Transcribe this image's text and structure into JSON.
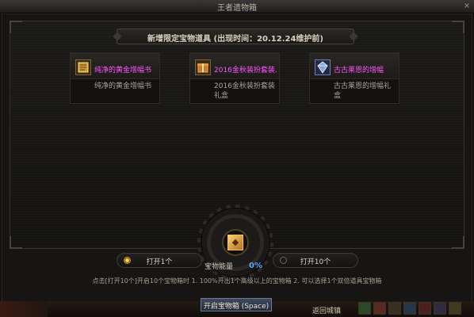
{
  "window": {
    "title": "王者遗物箱",
    "close_glyph": "×"
  },
  "banner": {
    "text": "新增限定宝物道具 (出现时间：20.12.24维护前)"
  },
  "items": [
    {
      "name": "纯净的黄金增幅书",
      "desc": "纯净的黄金增幅书",
      "icon": "gold-book-icon",
      "icon_color": "#c89a3a"
    },
    {
      "name": "2016金秋装扮套装…",
      "desc": "2016金秋装扮套装礼盒",
      "icon": "gift-box-icon",
      "icon_color": "#c77a2a"
    },
    {
      "name": "古古莱恩的增幅",
      "desc": "古古莱恩的增幅礼盒",
      "icon": "crystal-box-icon",
      "icon_color": "#8aa6d9"
    }
  ],
  "center": {
    "energy_label": "宝物能量",
    "energy_percent": "0%",
    "gem_glyph": "◆"
  },
  "options": {
    "open_one": "打开1个",
    "open_ten": "打开10个",
    "selected": "open_one"
  },
  "hint": "点击[打开10个]开启10个宝物箱时 1. 100%开出1个高级以上的宝物箱 2. 可以选择1个双倍道具宝物箱",
  "open_button": "开启宝物箱 (Space)",
  "gamebar": {
    "label": "返回城镇"
  },
  "colors": {
    "item_name": "#ff55ff",
    "percent": "#53a6ff"
  }
}
